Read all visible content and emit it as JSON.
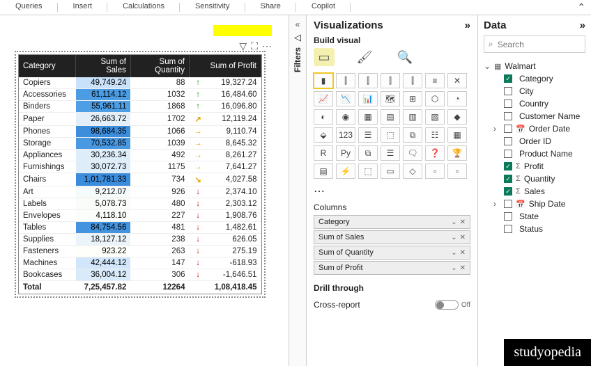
{
  "ribbon": {
    "tabs": [
      "Queries",
      "Insert",
      "Calculations",
      "Sensitivity",
      "Share",
      "Copilot"
    ]
  },
  "filters": {
    "label": "Filters"
  },
  "chart_data": {
    "type": "table",
    "headers": [
      "Category",
      "Sum of Sales",
      "Sum of Quantity",
      "Sum of Profit"
    ],
    "rows": [
      {
        "cat": "Copiers",
        "sales": "49,749.24",
        "salesFill": 0.49,
        "qty": "88",
        "arrow": "↑",
        "color": "#1a9a1a",
        "profit": "19,327.24"
      },
      {
        "cat": "Accessories",
        "sales": "61,114.12",
        "salesFill": 0.6,
        "qty": "1032",
        "arrow": "↑",
        "color": "#1a9a1a",
        "profit": "16,484.60"
      },
      {
        "cat": "Binders",
        "sales": "55,961.11",
        "salesFill": 0.55,
        "qty": "1868",
        "arrow": "↑",
        "color": "#1a9a1a",
        "profit": "16,096.80"
      },
      {
        "cat": "Paper",
        "sales": "26,663.72",
        "salesFill": 0.26,
        "qty": "1702",
        "arrow": "↗",
        "color": "#e6a400",
        "profit": "12,119.24"
      },
      {
        "cat": "Phones",
        "sales": "98,684.35",
        "salesFill": 0.97,
        "qty": "1066",
        "arrow": "→",
        "color": "#e6a400",
        "profit": "9,110.74"
      },
      {
        "cat": "Storage",
        "sales": "70,532.85",
        "salesFill": 0.69,
        "qty": "1039",
        "arrow": "→",
        "color": "#e6a400",
        "profit": "8,645.32"
      },
      {
        "cat": "Appliances",
        "sales": "30,236.34",
        "salesFill": 0.3,
        "qty": "492",
        "arrow": "→",
        "color": "#e6a400",
        "profit": "8,261.27"
      },
      {
        "cat": "Furnishings",
        "sales": "30,072.73",
        "salesFill": 0.3,
        "qty": "1175",
        "arrow": "→",
        "color": "#e6a400",
        "profit": "7,641.27"
      },
      {
        "cat": "Chairs",
        "sales": "1,01,781.33",
        "salesFill": 1.0,
        "qty": "734",
        "arrow": "↘",
        "color": "#e6a400",
        "profit": "4,027.58"
      },
      {
        "cat": "Art",
        "sales": "9,212.07",
        "salesFill": 0.09,
        "qty": "926",
        "arrow": "↓",
        "color": "#cc2020",
        "profit": "2,374.10"
      },
      {
        "cat": "Labels",
        "sales": "5,078.73",
        "salesFill": 0.05,
        "qty": "480",
        "arrow": "↓",
        "color": "#cc2020",
        "profit": "2,303.12"
      },
      {
        "cat": "Envelopes",
        "sales": "4,118.10",
        "salesFill": 0.04,
        "qty": "227",
        "arrow": "↓",
        "color": "#cc2020",
        "profit": "1,908.76"
      },
      {
        "cat": "Tables",
        "sales": "84,754.56",
        "salesFill": 0.83,
        "qty": "481",
        "arrow": "↓",
        "color": "#cc2020",
        "profit": "1,482.61"
      },
      {
        "cat": "Supplies",
        "sales": "18,127.12",
        "salesFill": 0.18,
        "qty": "238",
        "arrow": "↓",
        "color": "#cc2020",
        "profit": "626.05"
      },
      {
        "cat": "Fasteners",
        "sales": "923.22",
        "salesFill": 0.01,
        "qty": "263",
        "arrow": "↓",
        "color": "#cc2020",
        "profit": "275.19"
      },
      {
        "cat": "Machines",
        "sales": "42,444.12",
        "salesFill": 0.42,
        "qty": "147",
        "arrow": "↓",
        "color": "#cc2020",
        "profit": "-618.93"
      },
      {
        "cat": "Bookcases",
        "sales": "36,004.12",
        "salesFill": 0.35,
        "qty": "306",
        "arrow": "↓",
        "color": "#cc2020",
        "profit": "-1,646.51"
      }
    ],
    "totals": {
      "label": "Total",
      "sales": "7,25,457.82",
      "qty": "12264",
      "profit": "1,08,418.45"
    }
  },
  "viz": {
    "title": "Visualizations",
    "buildLabel": "Build visual",
    "columnsLabel": "Columns",
    "wells": [
      "Category",
      "Sum of Sales",
      "Sum of Quantity",
      "Sum of Profit"
    ],
    "drillLabel": "Drill through",
    "crossLabel": "Cross-report",
    "crossValue": "Off"
  },
  "data": {
    "title": "Data",
    "searchPlaceholder": "Search",
    "tableName": "Walmart",
    "fields": [
      {
        "name": "Category",
        "checked": true,
        "icon": "",
        "caret": ""
      },
      {
        "name": "City",
        "checked": false,
        "icon": "",
        "caret": ""
      },
      {
        "name": "Country",
        "checked": false,
        "icon": "",
        "caret": ""
      },
      {
        "name": "Customer Name",
        "checked": false,
        "icon": "",
        "caret": ""
      },
      {
        "name": "Order Date",
        "checked": false,
        "icon": "📅",
        "caret": "›"
      },
      {
        "name": "Order ID",
        "checked": false,
        "icon": "",
        "caret": ""
      },
      {
        "name": "Product Name",
        "checked": false,
        "icon": "",
        "caret": ""
      },
      {
        "name": "Profit",
        "checked": true,
        "icon": "Σ",
        "caret": ""
      },
      {
        "name": "Quantity",
        "checked": true,
        "icon": "Σ",
        "caret": ""
      },
      {
        "name": "Sales",
        "checked": true,
        "icon": "Σ",
        "caret": ""
      },
      {
        "name": "Ship Date",
        "checked": false,
        "icon": "📅",
        "caret": "›"
      },
      {
        "name": "State",
        "checked": false,
        "icon": "",
        "caret": ""
      },
      {
        "name": "Status",
        "checked": false,
        "icon": "",
        "caret": ""
      }
    ]
  },
  "watermark": "studyopedia"
}
